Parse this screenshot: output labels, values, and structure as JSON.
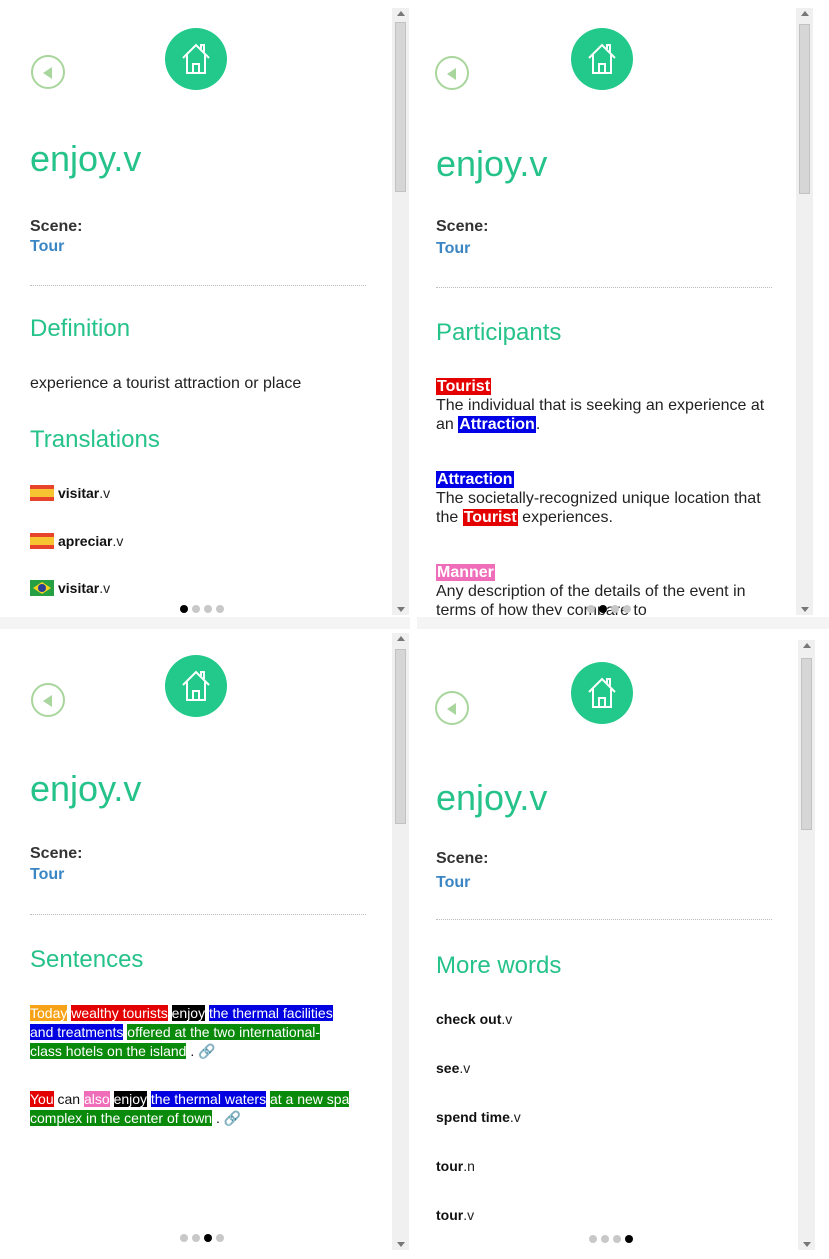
{
  "lemma": "enjoy.v",
  "scene": {
    "label": "Scene:",
    "value": "Tour"
  },
  "panels": {
    "definition": {
      "section_title": "Definition",
      "text": "experience a tourist attraction or place",
      "translations_title": "Translations",
      "translations": [
        {
          "flag": "spain-flag-icon",
          "word": "visitar",
          "pos": ".v"
        },
        {
          "flag": "spain-flag-icon",
          "word": "apreciar",
          "pos": ".v"
        },
        {
          "flag": "brazil-flag-icon",
          "word": "visitar",
          "pos": ".v"
        }
      ]
    },
    "participants": {
      "section_title": "Participants",
      "items": [
        {
          "name": "Tourist",
          "text_before": "The individual that is seeking an experience at an ",
          "ref": "Attraction",
          "text_after": "."
        },
        {
          "name": "Attraction",
          "text_before": "The societally-recognized unique location that the ",
          "ref": "Tourist",
          "text_after": " experiences."
        },
        {
          "name": "Manner",
          "text_before": "Any description of the details of the event in terms of how they compare to",
          "ref": "",
          "text_after": ""
        }
      ]
    },
    "sentences": {
      "section_title": "Sentences",
      "s1": {
        "a": "Today",
        "b": "wealthy tourists",
        "c": "enjoy",
        "d": "the thermal facilities and treatments",
        "e": "offered at the two international-class hotels on the island",
        "end": " ."
      },
      "s2": {
        "a": "You",
        "b": " can ",
        "c": "also",
        "d": "enjoy",
        "e": "the thermal waters",
        "f": "at a new spa complex in the center of town",
        "end": " ."
      }
    },
    "more_words": {
      "section_title": "More words",
      "items": [
        {
          "word": "check out",
          "pos": ".v"
        },
        {
          "word": "see",
          "pos": ".v"
        },
        {
          "word": "spend time",
          "pos": ".v"
        },
        {
          "word": "tour",
          "pos": ".n"
        },
        {
          "word": "tour",
          "pos": ".v"
        }
      ]
    }
  },
  "pagination": {
    "pages": 4,
    "active": [
      1,
      2,
      3,
      4
    ]
  },
  "colors": {
    "accent": "#25c28a",
    "scene_link": "#3a86c4",
    "fe_tourist": "#e50000",
    "fe_attraction": "#0000e6",
    "fe_manner": "#f06db9",
    "fe_time": "#f7a318",
    "fe_place": "#0a8a0a",
    "fe_target": "#000000"
  }
}
